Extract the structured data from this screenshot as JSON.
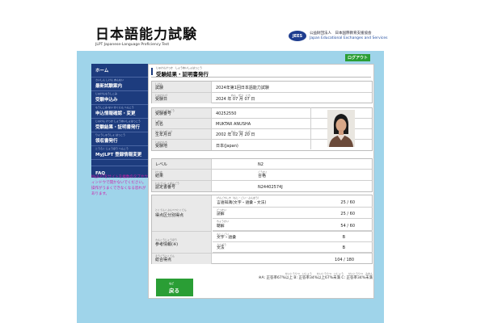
{
  "header": {
    "logo_title": "日本語能力試験",
    "logo_subtitle": "JLPT Japanese-Language Proficiency Test",
    "org_badge": "JEES",
    "org_name_ja": "公益財団法人　日本国際教育支援協会",
    "org_name_en": "Japan Educational Exchanges and Services"
  },
  "logout_label": "ログアウト",
  "sidebar": {
    "items": [
      {
        "ruby": "",
        "label": "ホーム"
      },
      {
        "ruby": "さいしん しけん あんない",
        "label": "最新試験案内"
      },
      {
        "ruby": "じゅけんもうしこみ",
        "label": "受験申込み"
      },
      {
        "ruby": "もうしこみ ない かくにん へんこう",
        "label": "申込情報確認・変更"
      },
      {
        "ruby": "じゅけん けっか しょうめいしょはっこう",
        "label": "受験結果・証明書発行"
      },
      {
        "ruby": "りょうしゅうしょ はっこう",
        "label": "領収書発行"
      },
      {
        "ruby": "とうろく じょうほう へんこう",
        "label": "MyJLPT 登録情報変更"
      },
      {
        "ruby": "",
        "label": "FAQ"
      }
    ],
    "note": "MyJLPTをサイトを複数のタブやウィンドウで開かないでください。操作がうまくできなくなる恐れがあります。"
  },
  "page": {
    "title_ruby": "じゅけんけっか　しょうめいしょはっこう",
    "title": "受験結果・証明書発行"
  },
  "exam": {
    "rows": [
      {
        "ruby": "しけん",
        "label": "試験",
        "value": "2024年第1回日本語能力試験",
        "value_ruby": ""
      },
      {
        "ruby": "じゅけんび",
        "label": "受験日",
        "value": "2024 年 07 月 07 日",
        "value_ruby": "ねん　がつ　にち"
      }
    ]
  },
  "personal": {
    "rows": [
      {
        "ruby": "じゅけんばんごう",
        "label": "受験番号",
        "value": "40252550",
        "value_ruby": ""
      },
      {
        "ruby": "しめい",
        "label": "氏名",
        "value": "MUKTAR ANUSHA",
        "value_ruby": ""
      },
      {
        "ruby": "せいねんがっぴ",
        "label": "生年月日",
        "value": "2002 年 02 月 20 日",
        "value_ruby": "ねん　がつ　にち"
      },
      {
        "ruby": "じゅけんち",
        "label": "受験地",
        "value": "日本(Japan)",
        "value_ruby": ""
      }
    ]
  },
  "result": {
    "rows": [
      {
        "ruby": "",
        "label": "レベル",
        "value": "N2",
        "value_ruby": ""
      },
      {
        "ruby": "けっか",
        "label": "結果",
        "value": "合格",
        "value_ruby": "ごうかく"
      },
      {
        "ruby": "にんていしょばんごう",
        "label": "認定書番号",
        "value": "N24402574J",
        "value_ruby": ""
      }
    ]
  },
  "scores": {
    "section_ruby": "とくてんくぶんべつとくてん",
    "section_label": "得点区分別得点",
    "items": [
      {
        "ruby": "げんごちしき（もじ・ごい・ぶんぽう）",
        "label": "言語知識(文字・語彙・文法)",
        "score": "25 / 60"
      },
      {
        "ruby": "どっかい",
        "label": "読解",
        "score": "25 / 60"
      },
      {
        "ruby": "ちょうかい",
        "label": "聴解",
        "score": "54 / 60"
      }
    ],
    "ref_ruby": "さんこうじょうほう",
    "ref_label": "参考情報(※)",
    "ref_items": [
      {
        "ruby": "もじ・ごい",
        "label": "文字・語彙",
        "score": "B"
      },
      {
        "ruby": "ぶんぽう",
        "label": "文法",
        "score": "B"
      }
    ],
    "total_ruby": "そうごうとくてん",
    "total_label": "総合得点",
    "total_score": "104 / 180"
  },
  "legend": {
    "ruby": "せいとうりつ　いじょう　　せいとうりつ　いじょう　　せいとうりつ　みまん",
    "text": "※A: 正答率67%以上  B: 正答率34%以上67%未満  C: 正答率34%未満"
  },
  "back_button": {
    "ruby": "もど",
    "label": "戻る"
  },
  "colors": {
    "navy": "#1d3c7e",
    "accent_green": "#2a9e35",
    "band": "#9fd4ea",
    "warning_text": "#cc22aa"
  }
}
